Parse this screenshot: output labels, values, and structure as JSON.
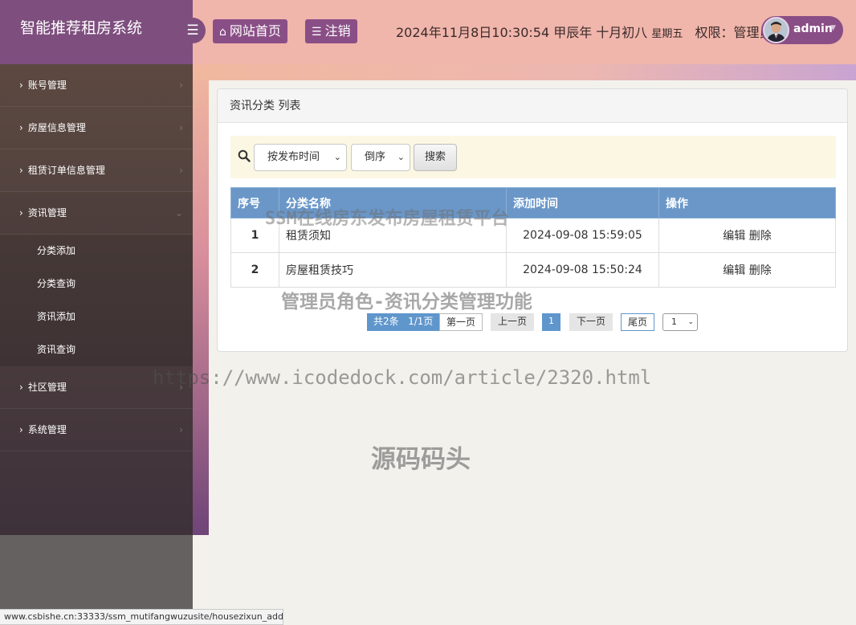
{
  "app": {
    "title": "智能推荐租房系统",
    "home_label": "网站首页",
    "logout_label": "注销",
    "datetime": "2024年11月8日10:30:54 甲辰年 十月初八",
    "weekday": "星期五",
    "role": "权限：管理员",
    "username": "admin"
  },
  "sidebar": {
    "items": [
      {
        "label": "账号管理"
      },
      {
        "label": "房屋信息管理"
      },
      {
        "label": "租赁订单信息管理"
      },
      {
        "label": "资讯管理",
        "sub": [
          "分类添加",
          "分类查询",
          "资讯添加",
          "资讯查询"
        ]
      },
      {
        "label": "社区管理"
      },
      {
        "label": "系统管理"
      }
    ]
  },
  "panel": {
    "title": "资讯分类 列表",
    "sort_field": "按发布时间",
    "sort_order": "倒序",
    "search_label": "搜索",
    "columns": [
      "序号",
      "分类名称",
      "添加时间",
      "操作"
    ],
    "rows": [
      {
        "no": "1",
        "name": "租赁须知",
        "time": "2024-09-08 15:59:05",
        "edit": "编辑",
        "del": "删除"
      },
      {
        "no": "2",
        "name": "房屋租赁技巧",
        "time": "2024-09-08 15:50:24",
        "edit": "编辑",
        "del": "删除"
      }
    ]
  },
  "pager": {
    "total": "共2条   1/1页",
    "first": "第一页",
    "prev": "上一页",
    "current": "1",
    "next": "下一页",
    "last": "尾页",
    "select": "1"
  },
  "watermarks": {
    "line1": "SSM在线房东发布房屋租赁平台",
    "line2": "管理员角色-资讯分类管理功能",
    "line3": "https://www.icodedock.com/article/2320.html",
    "line4": "源码码头"
  },
  "status_url": "www.csbishe.cn:33333/ssm_mutifangwuzusite/housezixun_add...."
}
